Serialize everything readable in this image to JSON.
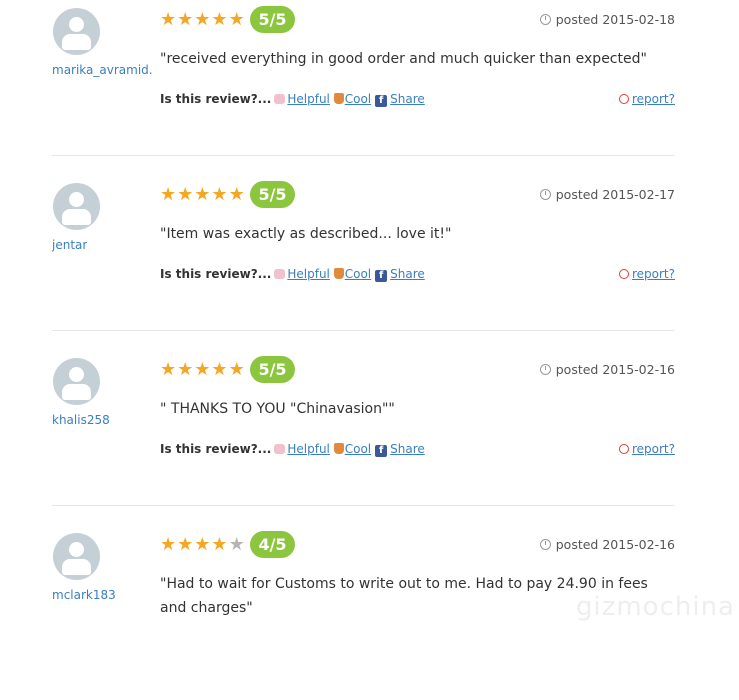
{
  "reviews": [
    {
      "username": "marika_avramid..",
      "stars_filled": 5,
      "stars_total": 5,
      "score": "5/5",
      "posted": "posted 2015-02-18",
      "text": "\"received everything in good order and much quicker than expected\"",
      "prompt": "Is this review?...",
      "helpful": "Helpful",
      "cool": "Cool",
      "share": "Share",
      "report": "report?"
    },
    {
      "username": "jentar",
      "stars_filled": 5,
      "stars_total": 5,
      "score": "5/5",
      "posted": "posted 2015-02-17",
      "text": "\"Item was exactly as described... love it!\"",
      "prompt": "Is this review?...",
      "helpful": "Helpful",
      "cool": "Cool",
      "share": "Share",
      "report": "report?"
    },
    {
      "username": "khalis258",
      "stars_filled": 5,
      "stars_total": 5,
      "score": "5/5",
      "posted": "posted 2015-02-16",
      "text": "\" THANKS TO YOU \"Chinavasion\"\"",
      "prompt": "Is this review?...",
      "helpful": "Helpful",
      "cool": "Cool",
      "share": "Share",
      "report": "report?"
    },
    {
      "username": "mclark183",
      "stars_filled": 4,
      "stars_total": 5,
      "score": "4/5",
      "posted": "posted 2015-02-16",
      "text": "\"Had to wait for Customs to write out to me. Had to pay 24.90 in fees and charges\""
    }
  ],
  "watermark": "gizmochina",
  "colors": {
    "star_filled": "#f5a623",
    "star_empty": "#b5b5b5",
    "score_badge": "#8cc63f",
    "link": "#3a7fc1",
    "report_icon": "#e03b3b"
  }
}
